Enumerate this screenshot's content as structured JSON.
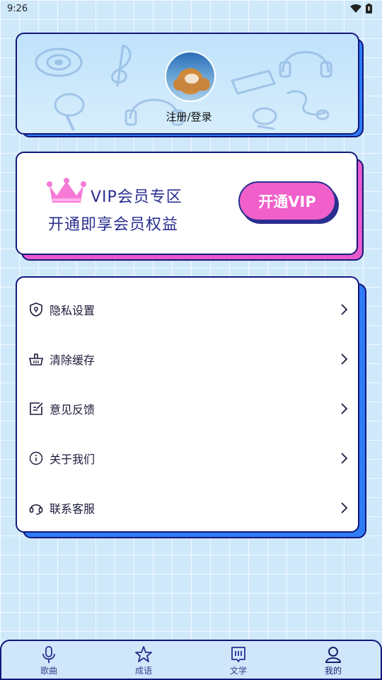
{
  "status_bar": {
    "time": "9:26",
    "wifi_icon": "wifi-icon",
    "battery_icon": "battery-icon"
  },
  "profile": {
    "login_label": "注册/登录",
    "avatar_icon": "dog-avatar"
  },
  "vip": {
    "title": "VIP会员专区",
    "subtitle": "开通即享会员权益",
    "button_label": "开通VIP",
    "colors": {
      "accent": "#f05fca",
      "shadow": "#e65bcb",
      "text": "#2a2f8f"
    }
  },
  "menu": {
    "items": [
      {
        "label": "隐私设置",
        "icon": "shield-icon"
      },
      {
        "label": "清除缓存",
        "icon": "basket-icon"
      },
      {
        "label": "意见反馈",
        "icon": "edit-icon"
      },
      {
        "label": "关于我们",
        "icon": "info-icon"
      },
      {
        "label": "联系客服",
        "icon": "headset-icon"
      }
    ]
  },
  "bottom_nav": {
    "items": [
      {
        "label": "歌曲",
        "icon": "microphone-icon"
      },
      {
        "label": "成语",
        "icon": "star-icon"
      },
      {
        "label": "文学",
        "icon": "book-icon"
      },
      {
        "label": "我的",
        "icon": "user-icon",
        "active": true
      }
    ]
  },
  "colors": {
    "background": "#cfe9fb",
    "border": "#14167a",
    "card_shadow_blue": "#2e7cf6"
  }
}
